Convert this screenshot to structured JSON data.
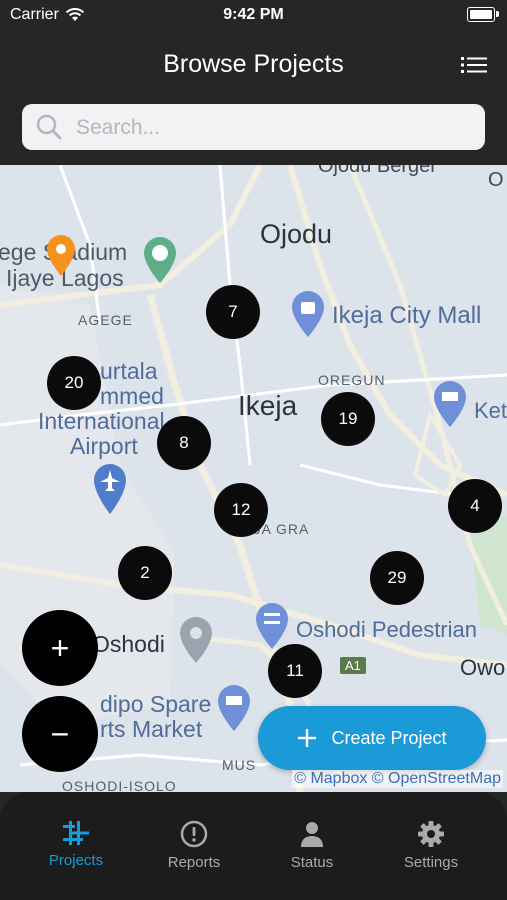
{
  "status_bar": {
    "carrier": "Carrier",
    "time": "9:42 PM"
  },
  "header": {
    "title": "Browse Projects",
    "menu_icon": "list-icon"
  },
  "search": {
    "placeholder": "Search...",
    "value": "",
    "icon": "search-icon"
  },
  "map": {
    "labels": {
      "ojodu_berger": "Ojodu Berger",
      "ojodu": "Ojodu",
      "stadium_1": "ege Stadium",
      "stadium_2": "Ijaye Lagos",
      "agege": "AGEGE",
      "ikeja_city_mall": "Ikeja City Mall",
      "oregun": "OREGUN",
      "ikeja": "Ikeja",
      "airport_1": "urtala",
      "airport_2": "mmed",
      "airport_3": "International",
      "airport_4": "Airport",
      "ket": "Ket",
      "gra": "IKEJA GRA",
      "oshodi": "Oshodi",
      "oshodi_ped": "Oshodi Pedestrian",
      "owo": "Owo",
      "spare_1": "dipo Spare",
      "spare_2": "rts Market",
      "mus": "MUS",
      "isolo": "OSHODI-ISOLO",
      "a1": "A1",
      "o_edge": "O"
    },
    "clusters": [
      "7",
      "20",
      "8",
      "19",
      "12",
      "4",
      "2",
      "29",
      "11"
    ],
    "attribution": "© Mapbox © OpenStreetMap"
  },
  "controls": {
    "zoom_in": "+",
    "zoom_out": "−"
  },
  "create_button": {
    "label": "Create Project"
  },
  "tabs": [
    {
      "label": "Projects",
      "icon": "projects-icon",
      "active": true
    },
    {
      "label": "Reports",
      "icon": "alert-circle-icon",
      "active": false
    },
    {
      "label": "Status",
      "icon": "person-icon",
      "active": false
    },
    {
      "label": "Settings",
      "icon": "gear-icon",
      "active": false
    }
  ],
  "colors": {
    "accent": "#1a9bd7",
    "bar_background": "#262626",
    "cluster": "#0b0b0b",
    "map_background": "#dde3ea",
    "marker": "#f5921e"
  }
}
